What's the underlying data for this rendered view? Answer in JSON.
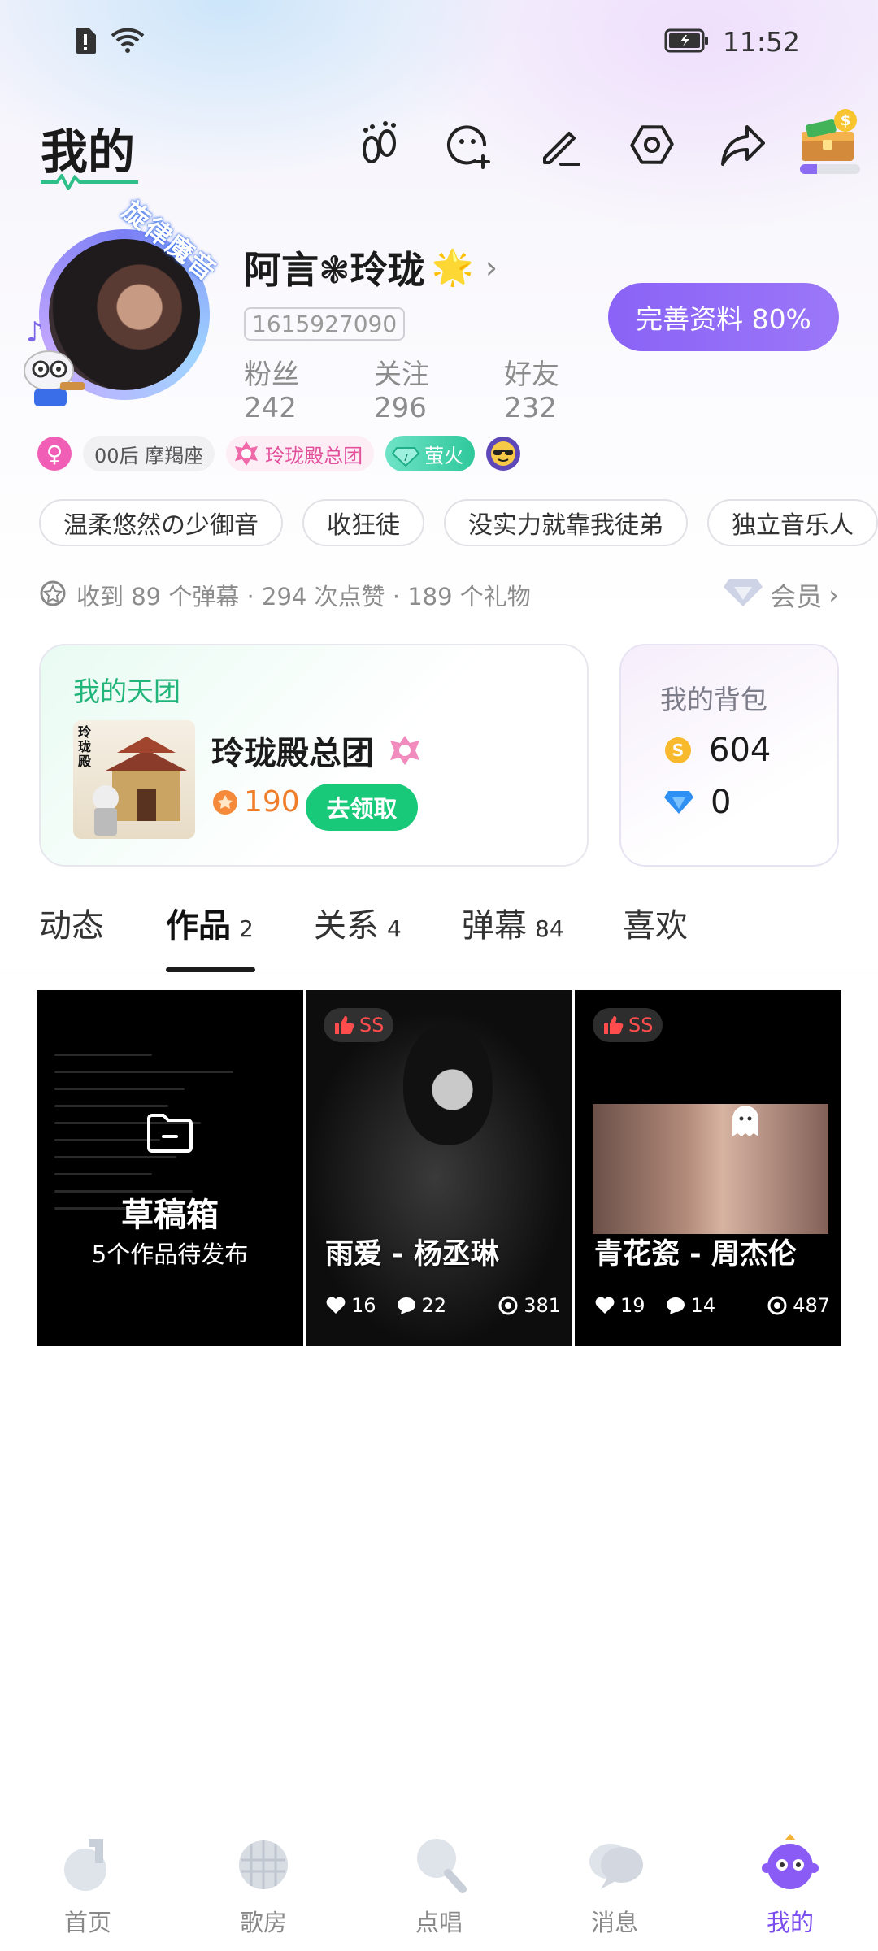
{
  "status_bar": {
    "time": "11:52"
  },
  "header": {
    "title": "我的",
    "icons": [
      "footprint-icon",
      "add-friend-icon",
      "edit-icon",
      "settings-icon",
      "share-icon",
      "treasure-chest-icon"
    ]
  },
  "profile": {
    "avatar_badge": "旋律魔音",
    "nickname": "阿言❃玲珑",
    "nickname_emoji": "🌟",
    "user_id": "1615927090",
    "stats": {
      "fans_label": "粉丝",
      "fans": "242",
      "following_label": "关注",
      "following": "296",
      "friends_label": "好友",
      "friends": "232"
    },
    "complete_button": "完善资料 80%"
  },
  "badges": {
    "gender_symbol": "♀",
    "age_zodiac": "00后 摩羯座",
    "group": "玲珑殿总团",
    "fire_level": "7",
    "fire": "萤火"
  },
  "tags": [
    "温柔悠然の少御音",
    "收狂徒",
    "没实力就靠我徒弟",
    "独立音乐人"
  ],
  "summary": {
    "text": "收到 89 个弹幕 · 294 次点赞 · 189 个礼物",
    "vip_label": "会员"
  },
  "team_card": {
    "title": "我的天团",
    "thumb_text": "玲\n珑\n殿",
    "name": "玲珑殿总团",
    "points": "190",
    "claim_button": "去领取"
  },
  "bag_card": {
    "title": "我的背包",
    "coins": "604",
    "diamonds": "0"
  },
  "tabs": [
    {
      "label": "动态",
      "count": ""
    },
    {
      "label": "作品",
      "count": "2"
    },
    {
      "label": "关系",
      "count": "4"
    },
    {
      "label": "弹幕",
      "count": "84"
    },
    {
      "label": "喜欢",
      "count": ""
    }
  ],
  "drafts": {
    "title": "草稿箱",
    "subtitle": "5个作品待发布"
  },
  "works": [
    {
      "badge": "SS",
      "title": "雨爱 - 杨丞琳",
      "likes": "16",
      "comments": "22",
      "views": "381"
    },
    {
      "badge": "SS",
      "title": "青花瓷 - 周杰伦",
      "likes": "19",
      "comments": "14",
      "views": "487"
    }
  ],
  "bottom_nav": [
    {
      "label": "首页",
      "active": false
    },
    {
      "label": "歌房",
      "active": false
    },
    {
      "label": "点唱",
      "active": false
    },
    {
      "label": "消息",
      "active": false
    },
    {
      "label": "我的",
      "active": true
    }
  ],
  "colors": {
    "accent": "#8a63f6",
    "green": "#19c97a",
    "team_green": "#22b57a",
    "pink": "#e2509c"
  }
}
